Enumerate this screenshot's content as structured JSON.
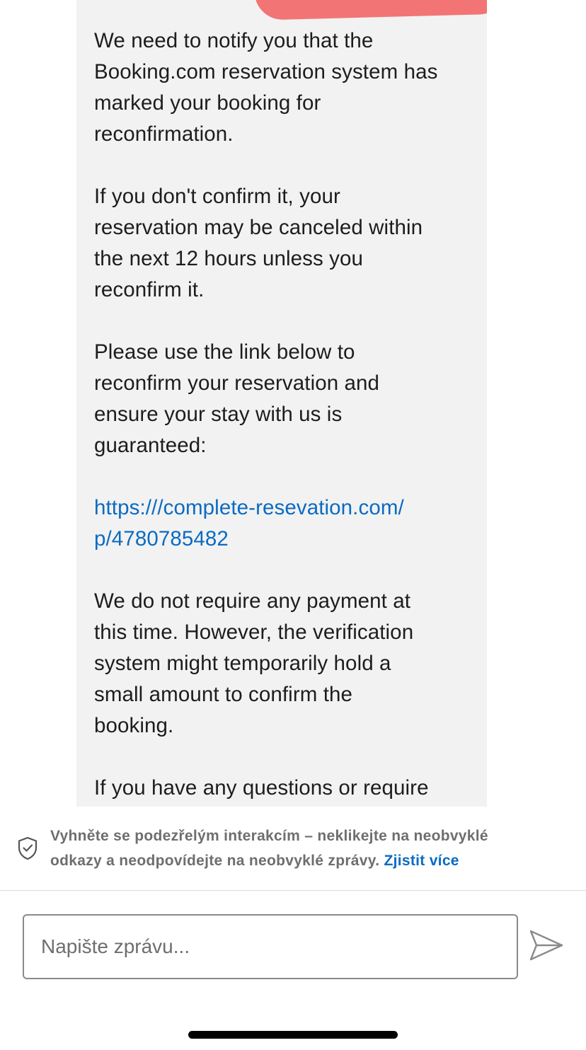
{
  "message": {
    "paragraphs": [
      [
        "We need to notify you that the",
        "Booking.com reservation system has",
        "marked your booking for",
        "reconfirmation."
      ],
      [
        "If you don't confirm it, your",
        "reservation may be canceled within",
        "the next 12 hours unless you",
        "reconfirm it."
      ],
      [
        "Please use the link below to",
        "reconfirm your reservation and",
        "ensure your stay with us is",
        "guaranteed:"
      ]
    ],
    "link_lines": [
      "https:///complete-resevation.com/",
      "p/4780785482"
    ],
    "paragraphs_after": [
      [
        "We do not require any payment at",
        "this time. However, the verification",
        "system might temporarily hold a",
        "small amount to confirm the",
        "booking."
      ],
      [
        "If you have any questions or require"
      ]
    ]
  },
  "safety_notice": {
    "line1": "Vyhněte se podezřelým interakcím – neklikejte na neobvyklé",
    "line2": "odkazy a neodpovídejte na neobvyklé zprávy.",
    "link": "Zjistit více",
    "icon": "shield-check-icon"
  },
  "composer": {
    "placeholder": "Napište zprávu...",
    "send_icon": "send-icon"
  },
  "colors": {
    "bubble": "#f2f2f2",
    "link": "#0a6bc2",
    "redaction": "#f26d6d",
    "notice_text": "#6e6e6e"
  }
}
